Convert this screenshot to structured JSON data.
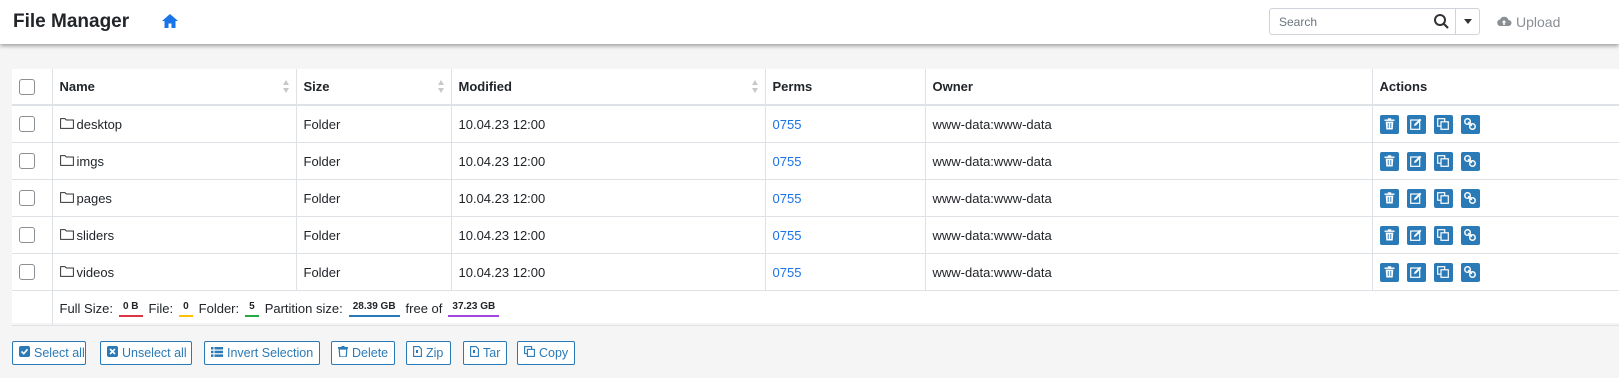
{
  "header": {
    "title": "File Manager",
    "search_placeholder": "Search",
    "upload_label": "Upload"
  },
  "table": {
    "columns": [
      "Name",
      "Size",
      "Modified",
      "Perms",
      "Owner",
      "Actions"
    ],
    "rows": [
      {
        "name": "desktop",
        "size": "Folder",
        "modified": "10.04.23 12:00",
        "perms": "0755",
        "owner": "www-data:www-data"
      },
      {
        "name": "imgs",
        "size": "Folder",
        "modified": "10.04.23 12:00",
        "perms": "0755",
        "owner": "www-data:www-data"
      },
      {
        "name": "pages",
        "size": "Folder",
        "modified": "10.04.23 12:00",
        "perms": "0755",
        "owner": "www-data:www-data"
      },
      {
        "name": "sliders",
        "size": "Folder",
        "modified": "10.04.23 12:00",
        "perms": "0755",
        "owner": "www-data:www-data"
      },
      {
        "name": "videos",
        "size": "Folder",
        "modified": "10.04.23 12:00",
        "perms": "0755",
        "owner": "www-data:www-data"
      }
    ],
    "row_actions": [
      "trash-icon",
      "edit-icon",
      "copy-icon",
      "link-icon"
    ]
  },
  "summary": {
    "full_size_label": "Full Size:",
    "full_size": "0 B",
    "file_label": "File:",
    "file_count": "0",
    "folder_label": "Folder:",
    "folder_count": "5",
    "partition_label": "Partition size:",
    "partition_size": "28.39 GB",
    "free_label": "free of",
    "total_size": "37.23 GB"
  },
  "bulk_actions": {
    "select_all": "Select all",
    "unselect_all": "Unselect all",
    "invert": "Invert Selection",
    "delete": "Delete",
    "zip": "Zip",
    "tar": "Tar",
    "copy": "Copy"
  },
  "colors": {
    "accent": "#2a7ab7",
    "link": "#1a73e8",
    "badge_full": "#dc3545",
    "badge_file": "#ffc107",
    "badge_folder": "#28a745",
    "badge_partition": "#2a7ab7",
    "badge_total": "#a347e1"
  }
}
